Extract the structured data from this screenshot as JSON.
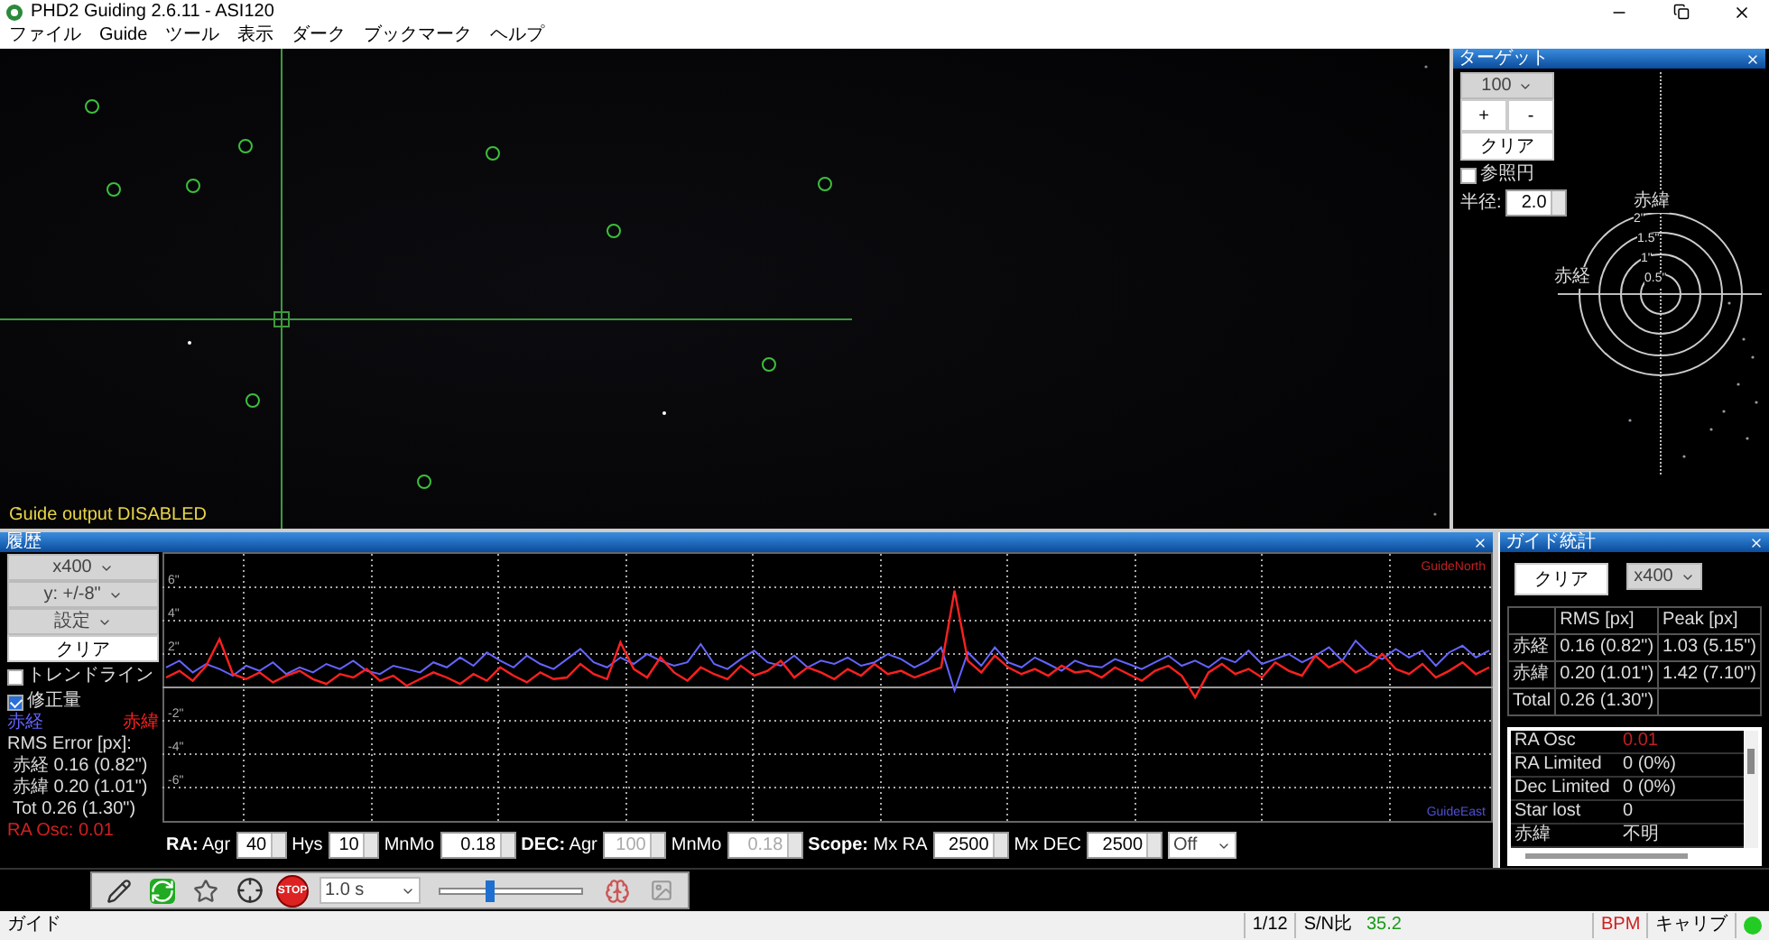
{
  "window": {
    "title": "PHD2 Guiding 2.6.11 - ASI120"
  },
  "menu": [
    "ファイル",
    "Guide",
    "ツール",
    "表示",
    "ダーク",
    "ブックマーク",
    "ヘルプ"
  ],
  "camera": {
    "kind": "picture",
    "overlay": "Guide output DISABLED"
  },
  "target": {
    "title": "ターゲット",
    "length": "100",
    "zoom_in": "+",
    "zoom_out": "-",
    "clear": "クリア",
    "ref_circle": {
      "label": "参照円",
      "checked": false
    },
    "radius": {
      "label": "半径:",
      "value": "2.0"
    },
    "axis_dec": "赤緯",
    "axis_ra": "赤経",
    "ring_labels": [
      "2\"",
      "1.5\"",
      "1\"",
      "0.5\""
    ]
  },
  "history": {
    "title": "履歴",
    "length": "x400",
    "scale": "y: +/-8\"",
    "settings": "設定",
    "clear": "クリア",
    "trendline": {
      "label": "トレンドライン",
      "checked": false
    },
    "corrections": {
      "label": "修正量",
      "checked": true
    },
    "rms_title": "RMS Error [px]:",
    "rms": [
      "赤経 0.16 (0.82\")",
      "赤緯 0.20 (1.01\")",
      "Tot 0.26 (1.30\")"
    ],
    "osc": "RA Osc: 0.01",
    "north_label": "GuideNorth",
    "east_label": "GuideEast",
    "chart_data": {
      "type": "line",
      "grid": true,
      "ylim": [
        -8,
        8
      ],
      "yticks": [
        {
          "value": 6,
          "label": "6\""
        },
        {
          "value": 4,
          "label": "4\""
        },
        {
          "value": 2,
          "label": "2\""
        },
        {
          "value": -2,
          "label": "-2\""
        },
        {
          "value": -4,
          "label": "-4\""
        },
        {
          "value": -6,
          "label": "-6\""
        }
      ],
      "series": [
        {
          "name": "赤経",
          "color": "#6464ff",
          "values": [
            1.2,
            1.6,
            0.9,
            1.4,
            1.1,
            0.7,
            1.3,
            1.0,
            1.5,
            0.8,
            1.2,
            0.9,
            1.4,
            1.1,
            1.6,
            1.0,
            0.8,
            1.3,
            1.1,
            0.9,
            1.5,
            1.2,
            1.8,
            1.3,
            2.1,
            1.6,
            1.2,
            1.9,
            1.4,
            1.1,
            1.7,
            2.3,
            1.5,
            1.2,
            1.8,
            1.4,
            2.0,
            1.6,
            1.3,
            1.5,
            2.6,
            1.4,
            1.1,
            1.7,
            2.2,
            1.5,
            1.3,
            1.9,
            1.2,
            1.6,
            1.4,
            1.8,
            1.3,
            1.5,
            2.0,
            1.7,
            1.2,
            1.6,
            2.4,
            -0.2,
            2.1,
            1.3,
            2.4,
            1.5,
            1.2,
            1.8,
            1.4,
            1.0,
            1.6,
            1.3,
            1.2,
            1.7,
            1.4,
            1.1,
            1.5,
            1.9,
            1.3,
            1.6,
            1.2,
            1.8,
            1.5,
            2.2,
            1.4,
            1.7,
            2.0,
            1.5,
            1.9,
            2.4,
            1.6,
            2.8,
            2.0,
            1.7,
            2.3,
            1.8,
            2.2,
            1.3,
            2.1,
            2.5,
            1.8,
            2.2
          ]
        },
        {
          "name": "赤緯",
          "color": "#ff2020",
          "values": [
            0.6,
            1.0,
            0.4,
            1.3,
            2.9,
            0.8,
            0.5,
            0.9,
            0.3,
            0.7,
            1.0,
            0.5,
            0.2,
            0.8,
            0.6,
            1.1,
            0.4,
            0.7,
            0.1,
            0.5,
            0.9,
            0.6,
            0.2,
            0.8,
            0.4,
            1.2,
            0.7,
            0.3,
            0.9,
            0.5,
            0.6,
            1.4,
            0.8,
            0.5,
            2.7,
            1.1,
            0.6,
            1.8,
            0.9,
            0.4,
            1.2,
            0.8,
            0.5,
            1.3,
            0.7,
            1.0,
            1.6,
            0.6,
            1.2,
            0.9,
            0.5,
            1.1,
            0.7,
            1.4,
            0.8,
            1.0,
            0.6,
            0.9,
            1.2,
            5.8,
            1.6,
            0.9,
            1.9,
            1.2,
            0.8,
            1.1,
            0.7,
            1.3,
            0.9,
            1.0,
            0.6,
            1.2,
            0.8,
            0.4,
            1.0,
            1.3,
            0.7,
            -0.6,
            0.9,
            1.4,
            0.8,
            1.1,
            0.6,
            1.5,
            1.0,
            0.7,
            1.9,
            1.2,
            1.6,
            0.9,
            1.3,
            2.0,
            1.1,
            0.8,
            1.4,
            0.6,
            1.0,
            1.5,
            0.8,
            1.2
          ]
        }
      ]
    }
  },
  "params": [
    {
      "label": "**RA:** Agr",
      "value": "40",
      "disabled": false
    },
    {
      "label": "Hys",
      "value": "10",
      "disabled": false
    },
    {
      "label": "MnMo",
      "value": "0.18",
      "disabled": false
    },
    {
      "label": "**DEC:** Agr",
      "value": "100",
      "disabled": true
    },
    {
      "label": "MnMo",
      "value": "0.18",
      "disabled": true
    },
    {
      "label": "**Scope:** Mx RA",
      "value": "2500",
      "disabled": false
    },
    {
      "label": "Mx DEC",
      "value": "2500",
      "disabled": false
    }
  ],
  "dec_mode": "Off",
  "stats": {
    "title": "ガイド統計",
    "clear": "クリア",
    "length": "x400",
    "columns": [
      "RMS [px]",
      "Peak [px]"
    ],
    "rows": [
      {
        "label": "赤経",
        "rms": "0.16 (0.82\")",
        "peak": "1.03 (5.15\")"
      },
      {
        "label": "赤緯",
        "rms": "0.20 (1.01\")",
        "peak": "1.42 (7.10\")"
      },
      {
        "label": "Total",
        "rms": "0.26 (1.30\")"
      }
    ],
    "items": [
      {
        "label": "RA Osc",
        "value": "0.01",
        "alert": true
      },
      {
        "label": "RA Limited",
        "value": "0 (0%)",
        "alert": false
      },
      {
        "label": "Dec Limited",
        "value": "0 (0%)",
        "alert": false
      },
      {
        "label": "Star lost",
        "value": "0",
        "alert": false
      },
      {
        "label": "赤緯",
        "value": "不明",
        "alert": false
      }
    ]
  },
  "toolbar": {
    "stop": "STOP",
    "exposure": "1.0 s",
    "gamma": {
      "level": 0.35
    }
  },
  "status": {
    "mode": "ガイド",
    "frame": "1/12",
    "snr_label": "S/N比",
    "snr": "35.2",
    "bpm": "BPM",
    "calib": "キャリブ"
  }
}
